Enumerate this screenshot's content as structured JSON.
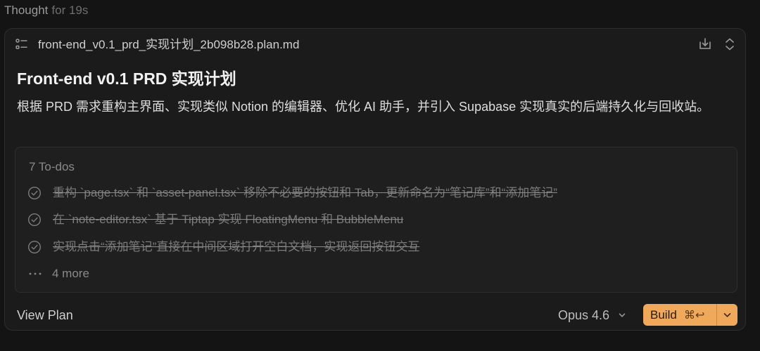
{
  "thought": {
    "label": "Thought",
    "duration": "for 19s"
  },
  "plan": {
    "filename": "front-end_v0.1_prd_实现计划_2b098b28.plan.md",
    "title": "Front-end v0.1 PRD 实现计划",
    "description": "根据 PRD 需求重构主界面、实现类似 Notion 的编辑器、优化 AI 助手，并引入 Supabase 实现真实的后端持久化与回收站。",
    "todos": {
      "count_label": "7 To-dos",
      "items": [
        {
          "text": "重构 `page.tsx` 和 `asset-panel.tsx` 移除不必要的按钮和 Tab，更新命名为“笔记库”和“添加笔记”",
          "done": true
        },
        {
          "text": "在 `note-editor.tsx` 基于 Tiptap 实现 FloatingMenu 和 BubbleMenu",
          "done": true
        },
        {
          "text": "实现点击“添加笔记”直接在中间区域打开空白文档，实现返回按钮交互",
          "done": true
        }
      ],
      "more_label": "4 more"
    },
    "footer": {
      "view_plan_label": "View Plan",
      "model_label": "Opus 4.6",
      "build_label": "Build",
      "build_shortcut": "⌘↩"
    }
  },
  "icons": {
    "header_left": "list-icon",
    "header_download": "download-icon",
    "header_expand": "expand-collapse-icon",
    "todo_check": "check-circle-icon",
    "more": "ellipsis-icon",
    "model_chevron": "chevron-down-icon",
    "build_menu": "chevron-down-icon"
  },
  "colors": {
    "background": "#141414",
    "card": "#1b1b1b",
    "build_accent": "#f0a95a"
  }
}
